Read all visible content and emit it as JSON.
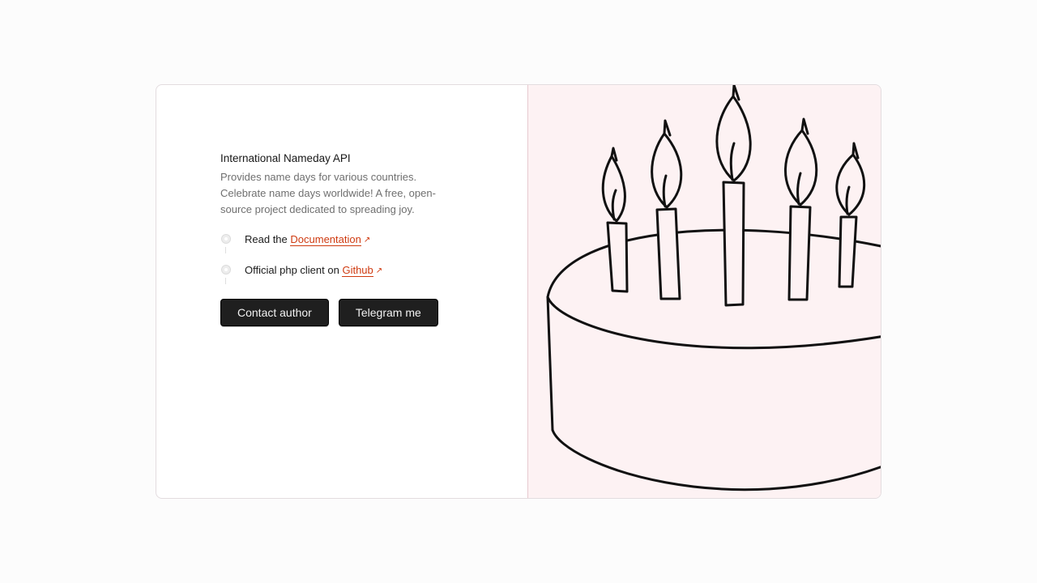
{
  "hero": {
    "title": "International Nameday API",
    "description": "Provides name days for various countries. Celebrate name days worldwide! A free, open-source project dedicated to spreading joy."
  },
  "steps": [
    {
      "prefix": "Read the",
      "link_label": "Documentation",
      "icon": "external-link-icon"
    },
    {
      "prefix": "Official php client on",
      "link_label": "Github",
      "icon": "external-link-icon"
    }
  ],
  "buttons": {
    "contact_label": "Contact author",
    "telegram_label": "Telegram me"
  },
  "illustration": {
    "name": "birthday-cake-with-candles",
    "background_color": "#fdf2f3"
  },
  "colors": {
    "accent": "#cf3a10",
    "button_bg": "#1f1f1f"
  }
}
